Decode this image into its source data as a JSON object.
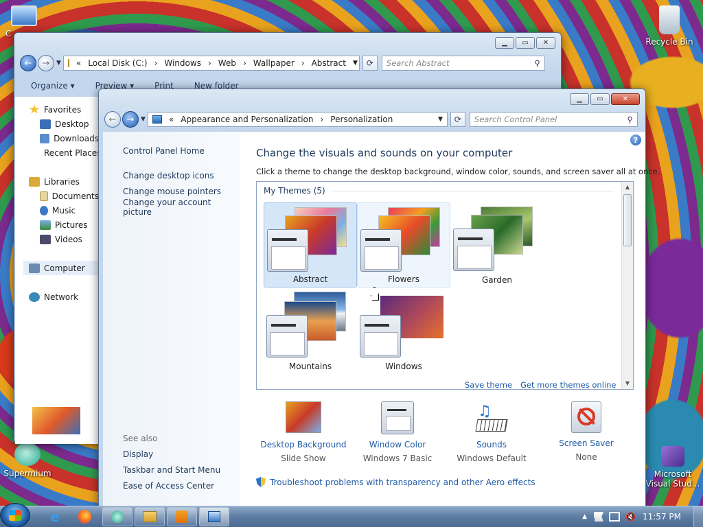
{
  "desktop": {
    "icons": [
      {
        "label": "C"
      },
      {
        "label": "Recycle Bin"
      },
      {
        "label": "Supermium"
      },
      {
        "label": "Microsoft Visual Stud..."
      }
    ]
  },
  "explorer": {
    "breadcrumb": [
      "«",
      "Local Disk (C:)",
      "Windows",
      "Web",
      "Wallpaper",
      "Abstract"
    ],
    "search_placeholder": "Search Abstract",
    "toolbar": [
      "Organize ▾",
      "Preview ▾",
      "Print",
      "New folder"
    ],
    "sidebar": {
      "favorites": {
        "title": "Favorites",
        "items": [
          "Desktop",
          "Downloads",
          "Recent Places"
        ]
      },
      "libraries": {
        "title": "Libraries",
        "items": [
          "Documents",
          "Music",
          "Pictures",
          "Videos"
        ]
      },
      "computer": "Computer",
      "network": "Network"
    }
  },
  "control_panel": {
    "breadcrumb": [
      "«",
      "Appearance and Personalization",
      "Personalization"
    ],
    "search_placeholder": "Search Control Panel",
    "left_links": [
      "Control Panel Home",
      "Change desktop icons",
      "Change mouse pointers",
      "Change your account picture"
    ],
    "see_also": {
      "title": "See also",
      "links": [
        "Display",
        "Taskbar and Start Menu",
        "Ease of Access Center"
      ]
    },
    "heading": "Change the visuals and sounds on your computer",
    "subheading": "Click a theme to change the desktop background, window color, sounds, and screen saver all at once.",
    "group_title": "My Themes (5)",
    "themes": [
      {
        "name": "Abstract",
        "state": "selected"
      },
      {
        "name": "Flowers",
        "state": "hover"
      },
      {
        "name": "Garden",
        "state": "normal"
      },
      {
        "name": "Mountains",
        "state": "normal"
      },
      {
        "name": "Windows",
        "state": "normal"
      }
    ],
    "theme_links": [
      "Save theme",
      "Get more themes online"
    ],
    "bottom_items": [
      {
        "label": "Desktop Background",
        "value": "Slide Show"
      },
      {
        "label": "Window Color",
        "value": "Windows 7 Basic"
      },
      {
        "label": "Sounds",
        "value": "Windows Default"
      },
      {
        "label": "Screen Saver",
        "value": "None"
      }
    ],
    "troubleshoot": "Troubleshoot problems with transparency and other Aero effects"
  },
  "taskbar": {
    "clock": "11:57 PM"
  },
  "colors": {
    "link": "#1e5aa8",
    "heading": "#1e395b",
    "selection": "#d5e6f8"
  }
}
